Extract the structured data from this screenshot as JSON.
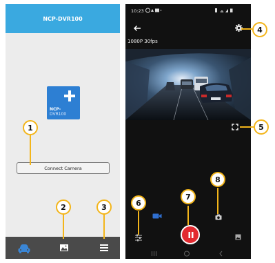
{
  "left_app": {
    "header_title": "NCP-DVR100",
    "add_tile": {
      "brand": "NCP-",
      "model": "DVR100"
    },
    "connect_button_label": "Connect Camera",
    "bottom_nav": [
      {
        "icon": "car-icon",
        "active": true
      },
      {
        "icon": "gallery-icon",
        "active": false
      },
      {
        "icon": "menu-icon",
        "active": false
      }
    ]
  },
  "right_app": {
    "status_time": "10:23",
    "resolution_label": "1080P 30fps",
    "icons": {
      "back": "back-arrow-icon",
      "settings": "gear-icon",
      "fullscreen": "fullscreen-icon",
      "settings_small": "sliders-icon",
      "video_mode": "video-camera-icon",
      "record": "pause-icon",
      "photo": "camera-icon",
      "gallery": "gallery-icon"
    }
  },
  "callouts": [
    "1",
    "2",
    "3",
    "4",
    "5",
    "6",
    "7",
    "8"
  ],
  "colors": {
    "header_blue": "#3aa9e0",
    "tile_blue": "#2d7fd3",
    "nav_gray": "#4a4a4a",
    "callout_orange": "#f3b51a",
    "record_red": "#e22a30"
  }
}
